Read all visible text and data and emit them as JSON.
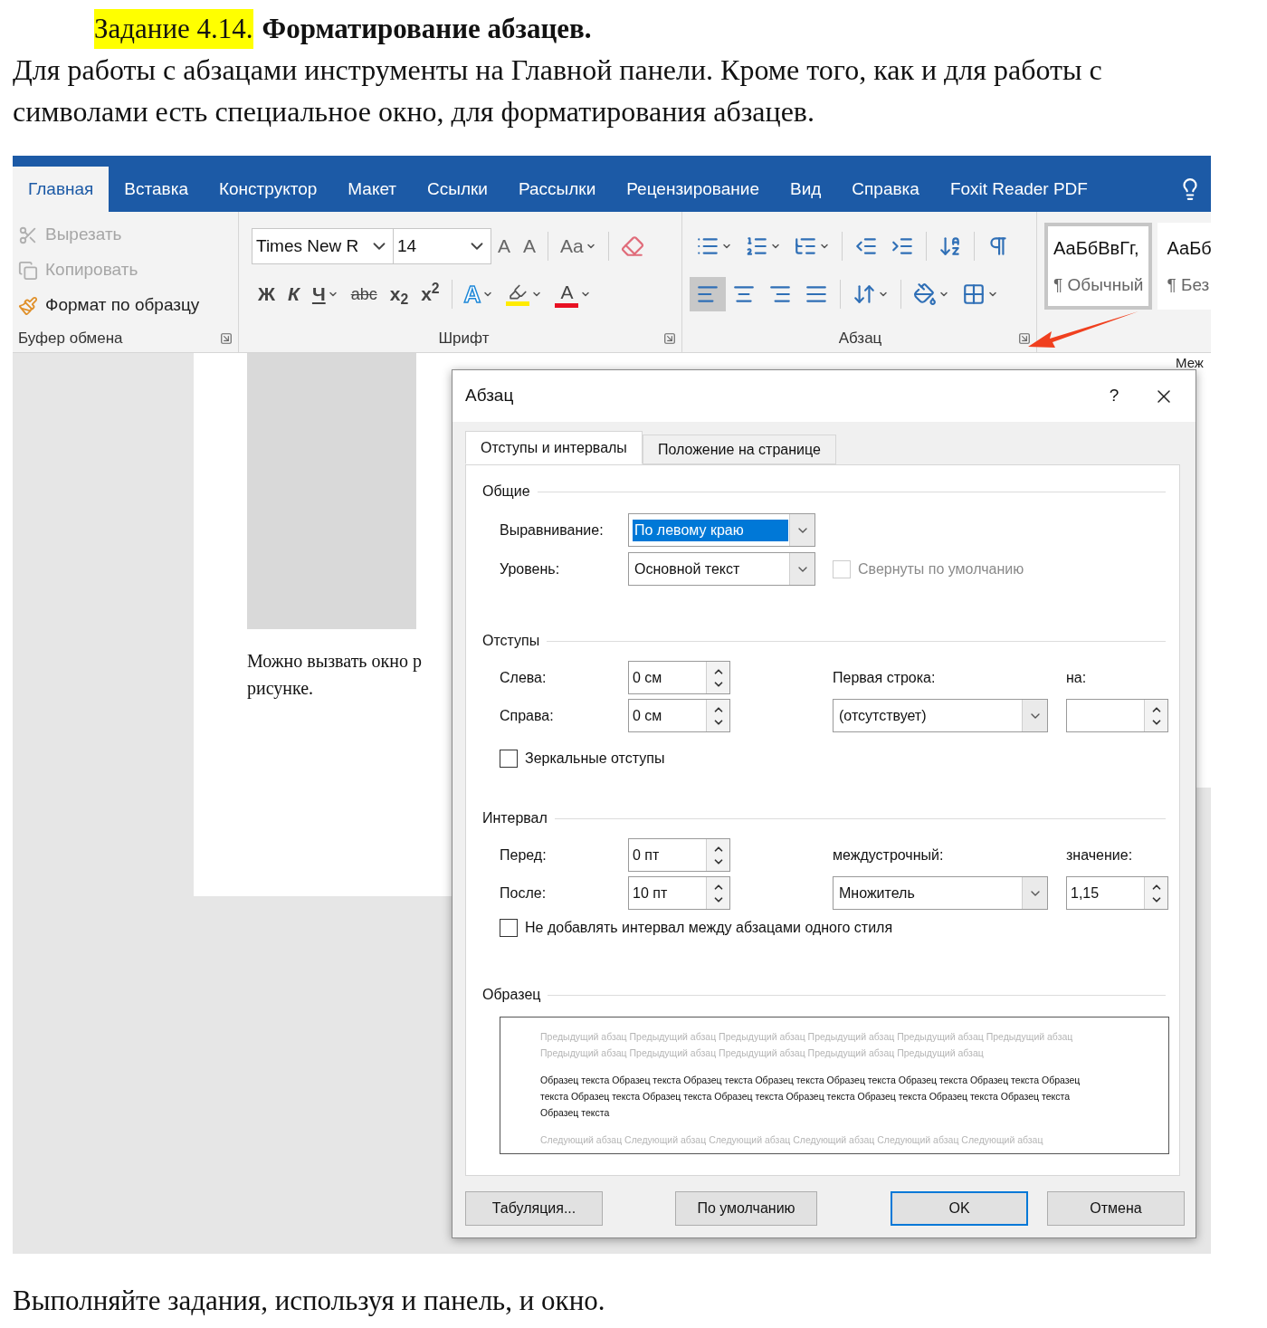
{
  "header": {
    "task_label": "Задание 4.14.",
    "title": "Форматирование абзацев.",
    "text": "Для работы с абзацами инструменты на Главной панели. Кроме того, как и для работы с символами есть специальное окно, для форматирования абзацев."
  },
  "ribbon": {
    "tabs": [
      {
        "label": "Главная",
        "selected": true
      },
      {
        "label": "Вставка",
        "selected": false
      },
      {
        "label": "Конструктор",
        "selected": false
      },
      {
        "label": "Макет",
        "selected": false
      },
      {
        "label": "Ссылки",
        "selected": false
      },
      {
        "label": "Рассылки",
        "selected": false
      },
      {
        "label": "Рецензирование",
        "selected": false
      },
      {
        "label": "Вид",
        "selected": false
      },
      {
        "label": "Справка",
        "selected": false
      },
      {
        "label": "Foxit Reader PDF",
        "selected": false
      }
    ],
    "clipboard": {
      "label": "Буфер обмена",
      "items": [
        {
          "kind": "cut",
          "label": "Вырезать",
          "disabled": true
        },
        {
          "kind": "copy",
          "label": "Копировать",
          "disabled": true
        },
        {
          "kind": "painter",
          "label": "Формат по образцу",
          "disabled": false
        }
      ]
    },
    "font": {
      "label": "Шрифт",
      "name": "Times New R",
      "size": "14",
      "top_tools": [
        {
          "kind": "grow",
          "label": "A"
        },
        {
          "kind": "shrink",
          "label": "A"
        },
        {
          "kind": "separator"
        },
        {
          "kind": "case",
          "label": "Aa",
          "dropdown": true
        },
        {
          "kind": "separator"
        },
        {
          "kind": "clear"
        }
      ],
      "bottom_tools": [
        {
          "kind": "bold",
          "label": "Ж"
        },
        {
          "kind": "italic",
          "label": "К"
        },
        {
          "kind": "underline",
          "label": "Ч",
          "dropdown": true
        },
        {
          "kind": "strike",
          "label": "abc"
        },
        {
          "kind": "script",
          "label": "x$_{2}$"
        },
        {
          "kind": "script",
          "label": "x$^{2}$"
        },
        {
          "kind": "separator"
        },
        {
          "kind": "effects",
          "label": "A",
          "dropdown": true
        },
        {
          "kind": "highlight",
          "dropdown": true
        },
        {
          "kind": "color",
          "label": "A",
          "dropdown": true
        }
      ]
    },
    "paragraph": {
      "label": "Абзац",
      "top_tools": [
        {
          "kind": "bullets",
          "dropdown": true
        },
        {
          "kind": "numbering",
          "dropdown": true
        },
        {
          "kind": "multilevel",
          "dropdown": true
        },
        {
          "kind": "separator"
        },
        {
          "kind": "outdent"
        },
        {
          "kind": "indent"
        },
        {
          "kind": "separator"
        },
        {
          "kind": "sort"
        },
        {
          "kind": "separator"
        },
        {
          "kind": "pilcrow"
        }
      ],
      "bottom_tools": [
        {
          "kind": "align_left",
          "selected": true
        },
        {
          "kind": "align_center",
          "selected": false
        },
        {
          "kind": "align_right",
          "selected": false
        },
        {
          "kind": "justify",
          "selected": false
        },
        {
          "kind": "separator"
        },
        {
          "kind": "line_spacing",
          "dropdown": true
        },
        {
          "kind": "separator"
        },
        {
          "kind": "shading",
          "dropdown": true
        },
        {
          "kind": "borders",
          "dropdown": true
        }
      ]
    },
    "styles": [
      {
        "preview": "АаБбВвГг,",
        "name": "¶ Обычный",
        "selected": true
      },
      {
        "preview": "АаБб",
        "name": "¶ Без",
        "selected": false
      }
    ]
  },
  "document": {
    "page_lines": [
      "Можно вызвать окно р",
      "рисунке."
    ],
    "side_panel": {
      "heading": "Меж"
    }
  },
  "dialog": {
    "title": "Абзац",
    "help": "?",
    "tabs": [
      {
        "label": "Отступы и интервалы",
        "selected": true
      },
      {
        "label": "Положение на странице",
        "selected": false
      }
    ],
    "general": {
      "heading": "Общие",
      "alignment": {
        "label": "Выравнивание:",
        "value": "По левому краю",
        "highlighted": true
      },
      "level": {
        "label": "Уровень:",
        "value": "Основной текст",
        "highlighted": false
      },
      "collapsed": {
        "label": "Свернуты по умолчанию",
        "checked": false,
        "disabled": true
      }
    },
    "indents": {
      "heading": "Отступы",
      "left": {
        "label": "Слева:",
        "value": "0 см"
      },
      "right": {
        "label": "Справа:",
        "value": "0 см"
      },
      "first_line": {
        "label": "Первая строка:",
        "value": "(отсутствует)",
        "highlighted": false
      },
      "by": {
        "label": "на:"
      },
      "mirror": {
        "label": "Зеркальные отступы",
        "checked": false,
        "disabled": false
      }
    },
    "spacing": {
      "heading": "Интервал",
      "before": {
        "label": "Перед:",
        "value": "0 пт"
      },
      "after": {
        "label": "После:",
        "value": "10 пт"
      },
      "line": {
        "label": "междустрочный:",
        "value": "Множитель",
        "highlighted": false
      },
      "at": {
        "label": "значение:",
        "value": "1,15"
      },
      "no_space": {
        "label": "Не добавлять интервал между абзацами одного стиля",
        "checked": false,
        "disabled": false
      }
    },
    "preview": {
      "heading": "Образец",
      "previous": "Предыдущий абзац Предыдущий абзац Предыдущий абзац Предыдущий абзац Предыдущий абзац Предыдущий абзац Предыдущий абзац Предыдущий абзац Предыдущий абзац Предыдущий абзац Предыдущий абзац",
      "sample": "Образец текста Образец текста Образец текста Образец текста Образец текста Образец текста Образец текста Образец текста Образец текста Образец текста Образец текста Образец текста Образец текста Образец текста Образец текста Образец текста",
      "next": "Следующий абзац Следующий абзац Следующий абзац Следующий абзац Следующий абзац Следующий абзац"
    },
    "buttons": [
      {
        "label": "Табуляция...",
        "default": false
      },
      {
        "label": "По умолчанию",
        "default": false
      },
      {
        "label": "OK",
        "default": true
      },
      {
        "label": "Отмена",
        "default": false
      }
    ]
  },
  "footer": "Выполняйте задания, используя и панель, и окно."
}
